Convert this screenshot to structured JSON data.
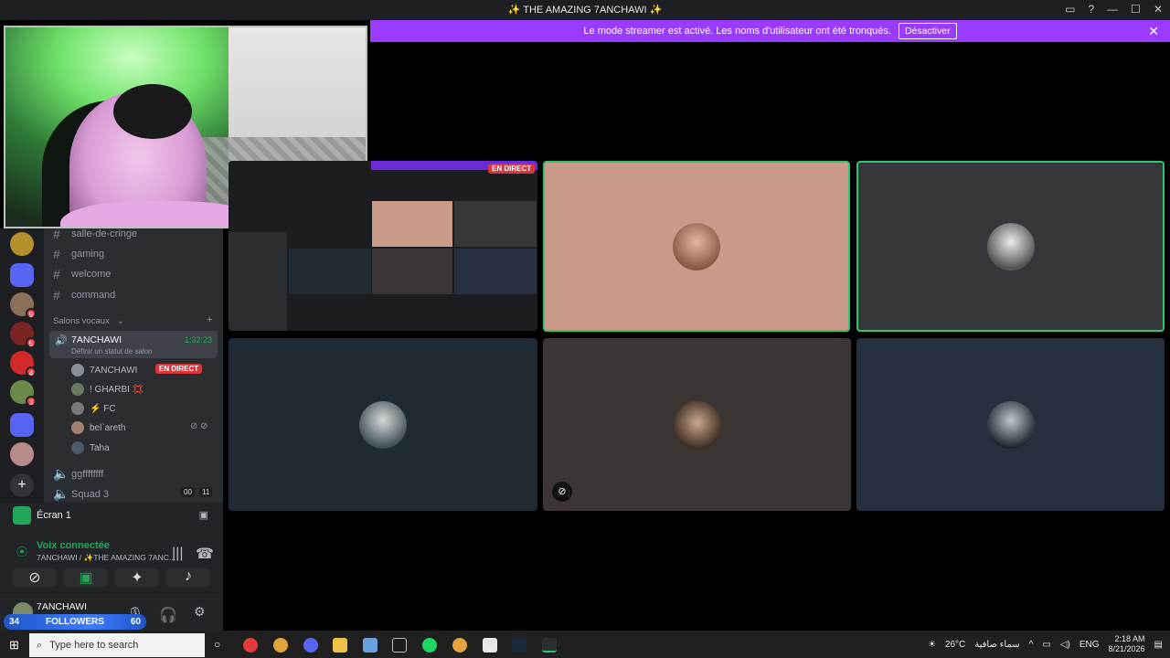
{
  "window": {
    "title": "✨ THE AMAZING 7ANCHAWI ✨",
    "icons": [
      "inbox-icon",
      "help-icon",
      "minimize-icon",
      "maximize-icon",
      "close-icon"
    ]
  },
  "banner": {
    "text": "Le mode streamer est activé. Les noms d'utilisateur ont été tronqués.",
    "button": "Désactiver"
  },
  "channels": {
    "text": [
      "salle-de-cringe",
      "gaming",
      "welcome",
      "command"
    ],
    "voice_header": "Salons vocaux",
    "voice_channel": {
      "name": "7ANCHAWI",
      "timer": "1:32:23",
      "status": "Définir un statut de salon"
    },
    "voice_users": [
      {
        "name": "7ANCHAWI",
        "badge": "EN DIRECT"
      },
      {
        "name": "! GHARBI 💢"
      },
      {
        "name": "⚡ FC"
      },
      {
        "name": "bel`areth"
      },
      {
        "name": "Taha"
      }
    ],
    "other_voice": [
      {
        "name": "ggffffffff"
      },
      {
        "name": "Squad 3",
        "count_a": "00",
        "count_b": "11"
      }
    ]
  },
  "screen_panel": {
    "label": "Écran 1"
  },
  "voice_panel": {
    "status": "Voix connectée",
    "location": "7ANCHAWI / ✨THE AMAZING 7ANC..."
  },
  "user_panel": {
    "name": "7ANCHAWI"
  },
  "followers": {
    "left": "34",
    "label": "FOLLOWERS",
    "right": "60"
  },
  "mini_share": {
    "badge": "EN DIRECT"
  },
  "tiles": [
    {
      "name": "tile-speaker-1",
      "bg": "#c9998a",
      "speaking": true
    },
    {
      "name": "tile-speaker-2",
      "bg": "#36373b",
      "speaking": true
    },
    {
      "name": "tile-user-3",
      "bg": "#1f2a33",
      "speaking": false
    },
    {
      "name": "tile-user-4",
      "bg": "#3b3633",
      "speaking": false
    },
    {
      "name": "tile-user-5",
      "bg": "#27303f",
      "speaking": false
    }
  ],
  "taskbar": {
    "search_placeholder": "Type here to search",
    "weather": "26°C",
    "weather_text": "سماء صافية",
    "lang": "ENG",
    "time": "2:18 AM",
    "date": "8/21/2026"
  }
}
